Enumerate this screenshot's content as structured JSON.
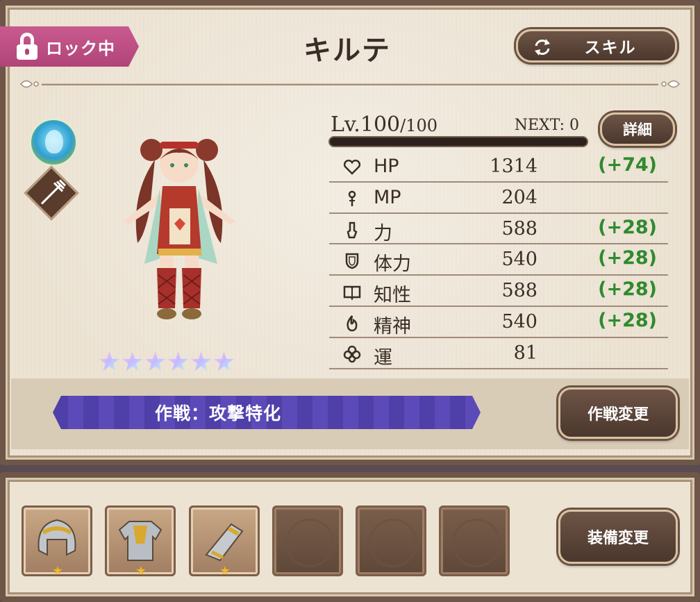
{
  "header": {
    "lock_label": "ロック中",
    "character_name": "キルテ",
    "skill_button": "スキル"
  },
  "level": {
    "label": "Lv.",
    "current": "100",
    "max": "/100",
    "next": "NEXT: 0",
    "exp_fraction": 1.0
  },
  "detail_button": "詳細",
  "stats": [
    {
      "icon": "heart-icon",
      "label": "HP",
      "value": "1314",
      "bonus": "(+74)"
    },
    {
      "icon": "staff-icon",
      "label": "MP",
      "value": "204",
      "bonus": ""
    },
    {
      "icon": "fist-icon",
      "label": "力",
      "value": "588",
      "bonus": "(+28)"
    },
    {
      "icon": "shield-icon",
      "label": "体力",
      "value": "540",
      "bonus": "(+28)"
    },
    {
      "icon": "book-icon",
      "label": "知性",
      "value": "588",
      "bonus": "(+28)"
    },
    {
      "icon": "flame-icon",
      "label": "精神",
      "value": "540",
      "bonus": "(+28)"
    },
    {
      "icon": "clover-icon",
      "label": "運",
      "value": "81",
      "bonus": ""
    }
  ],
  "rarity_stars": 6,
  "strategy": {
    "label": "作戦：攻撃特化",
    "change_button": "作戦変更"
  },
  "equipment": {
    "slots": [
      {
        "item": "helmet-icon",
        "stars": 1
      },
      {
        "item": "armor-icon",
        "stars": 1
      },
      {
        "item": "gauntlet-icon",
        "stars": 1
      },
      {
        "item": "empty",
        "stars": 0
      },
      {
        "item": "empty",
        "stars": 0
      },
      {
        "item": "empty",
        "stars": 0
      }
    ],
    "change_button": "装備変更"
  },
  "colors": {
    "lock_tag": "#b04478",
    "bonus_text": "#2f8a2f",
    "strategy_bar": "#4f3fa8",
    "button_bg": "#5a4236"
  }
}
